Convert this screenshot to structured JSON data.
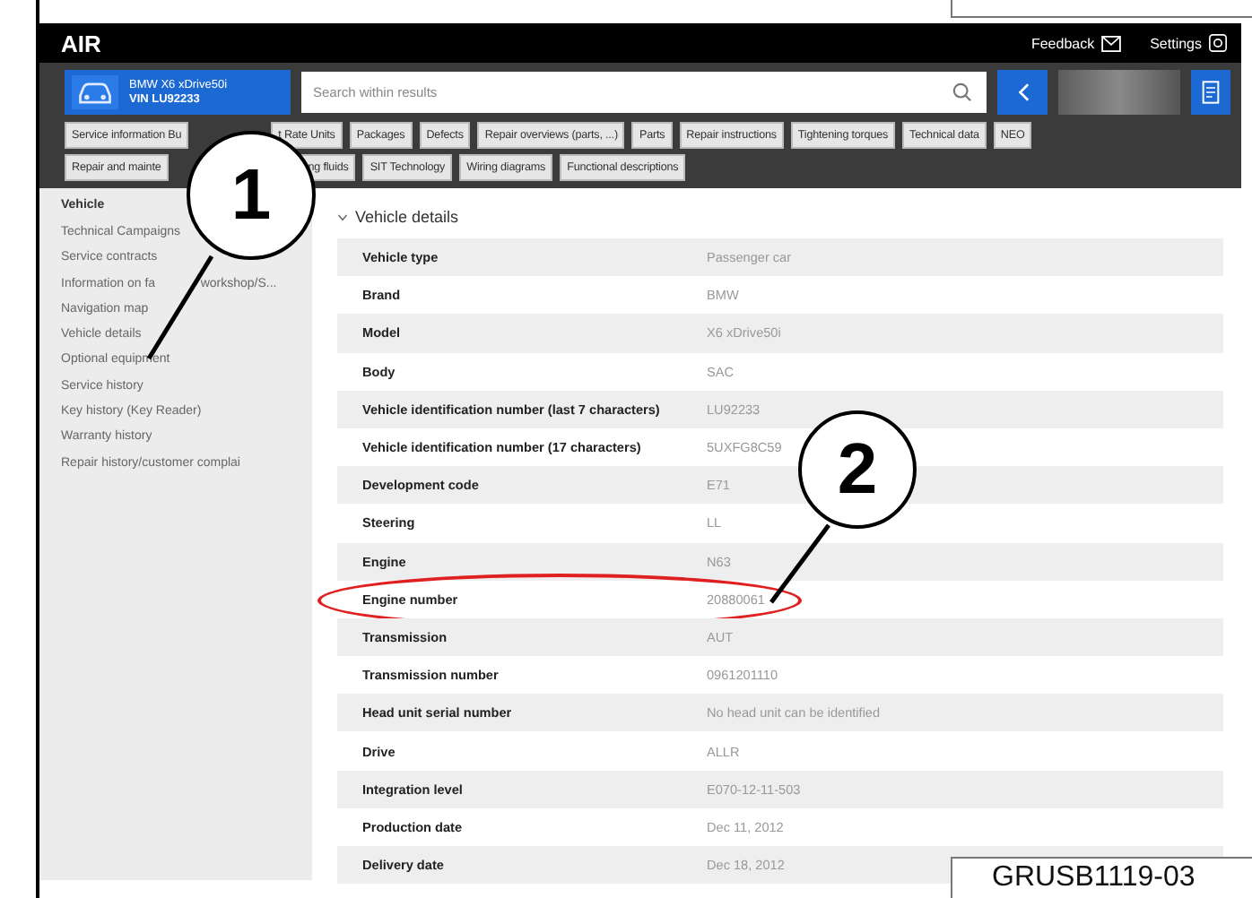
{
  "header": {
    "title": "AIR",
    "feedback": "Feedback",
    "settings": "Settings"
  },
  "toolbar": {
    "vehicle_line1": "BMW X6 xDrive50i",
    "vehicle_line2": "VIN LU92233",
    "search": {
      "placeholder": "Search within results"
    }
  },
  "chip_rows": [
    [
      "Service information Bu",
      "t Rate Units",
      "Packages",
      "Defects",
      "Repair overviews (parts, ...)",
      "Parts",
      "Repair instructions",
      "Tightening torques",
      "Technical data",
      "NEO"
    ],
    [
      "Repair and mainte",
      "ng fluids",
      "SIT Technology",
      "Wiring diagrams",
      "Functional descriptions"
    ]
  ],
  "sidebar": {
    "heading": "Vehicle",
    "items": [
      "Technical Campaigns",
      "Service contracts",
      "Information on fa             workshop/S...",
      "Navigation map",
      "Vehicle details",
      "Optional equipment",
      "Service history",
      "Key history (Key Reader)",
      "Warranty history",
      "Repair history/customer complai"
    ]
  },
  "details": {
    "heading": "Vehicle details",
    "rows": [
      {
        "label": "Vehicle type",
        "value": "Passenger car",
        "highlighted": false
      },
      {
        "label": "Brand",
        "value": "BMW",
        "highlighted": false
      },
      {
        "label": "Model",
        "value": "X6 xDrive50i",
        "highlighted": false
      },
      {
        "label": "Body",
        "value": "SAC",
        "highlighted": false
      },
      {
        "label": "Vehicle identification number (last 7 characters)",
        "value": "LU92233",
        "highlighted": false
      },
      {
        "label": "Vehicle identification number (17 characters)",
        "value": "5UXFG8C59",
        "highlighted": false
      },
      {
        "label": "Development code",
        "value": "E71",
        "highlighted": false
      },
      {
        "label": "Steering",
        "value": "LL",
        "highlighted": false
      },
      {
        "label": "Engine",
        "value": "N63",
        "highlighted": false
      },
      {
        "label": "Engine number",
        "value": "20880061",
        "highlighted": true
      },
      {
        "label": "Transmission",
        "value": "AUT",
        "highlighted": false
      },
      {
        "label": "Transmission number",
        "value": "0961201110",
        "highlighted": false
      },
      {
        "label": "Head unit serial number",
        "value": "No head unit can be identified",
        "highlighted": false
      },
      {
        "label": "Drive",
        "value": "ALLR",
        "highlighted": false
      },
      {
        "label": "Integration level",
        "value": "E070-12-11-503",
        "highlighted": false
      },
      {
        "label": "Production date",
        "value": "Dec 11, 2012",
        "highlighted": false
      },
      {
        "label": "Delivery date",
        "value": "Dec 18, 2012",
        "highlighted": false
      }
    ]
  },
  "callouts": [
    "1",
    "2"
  ],
  "figure_label": "GRUSB1119-03"
}
